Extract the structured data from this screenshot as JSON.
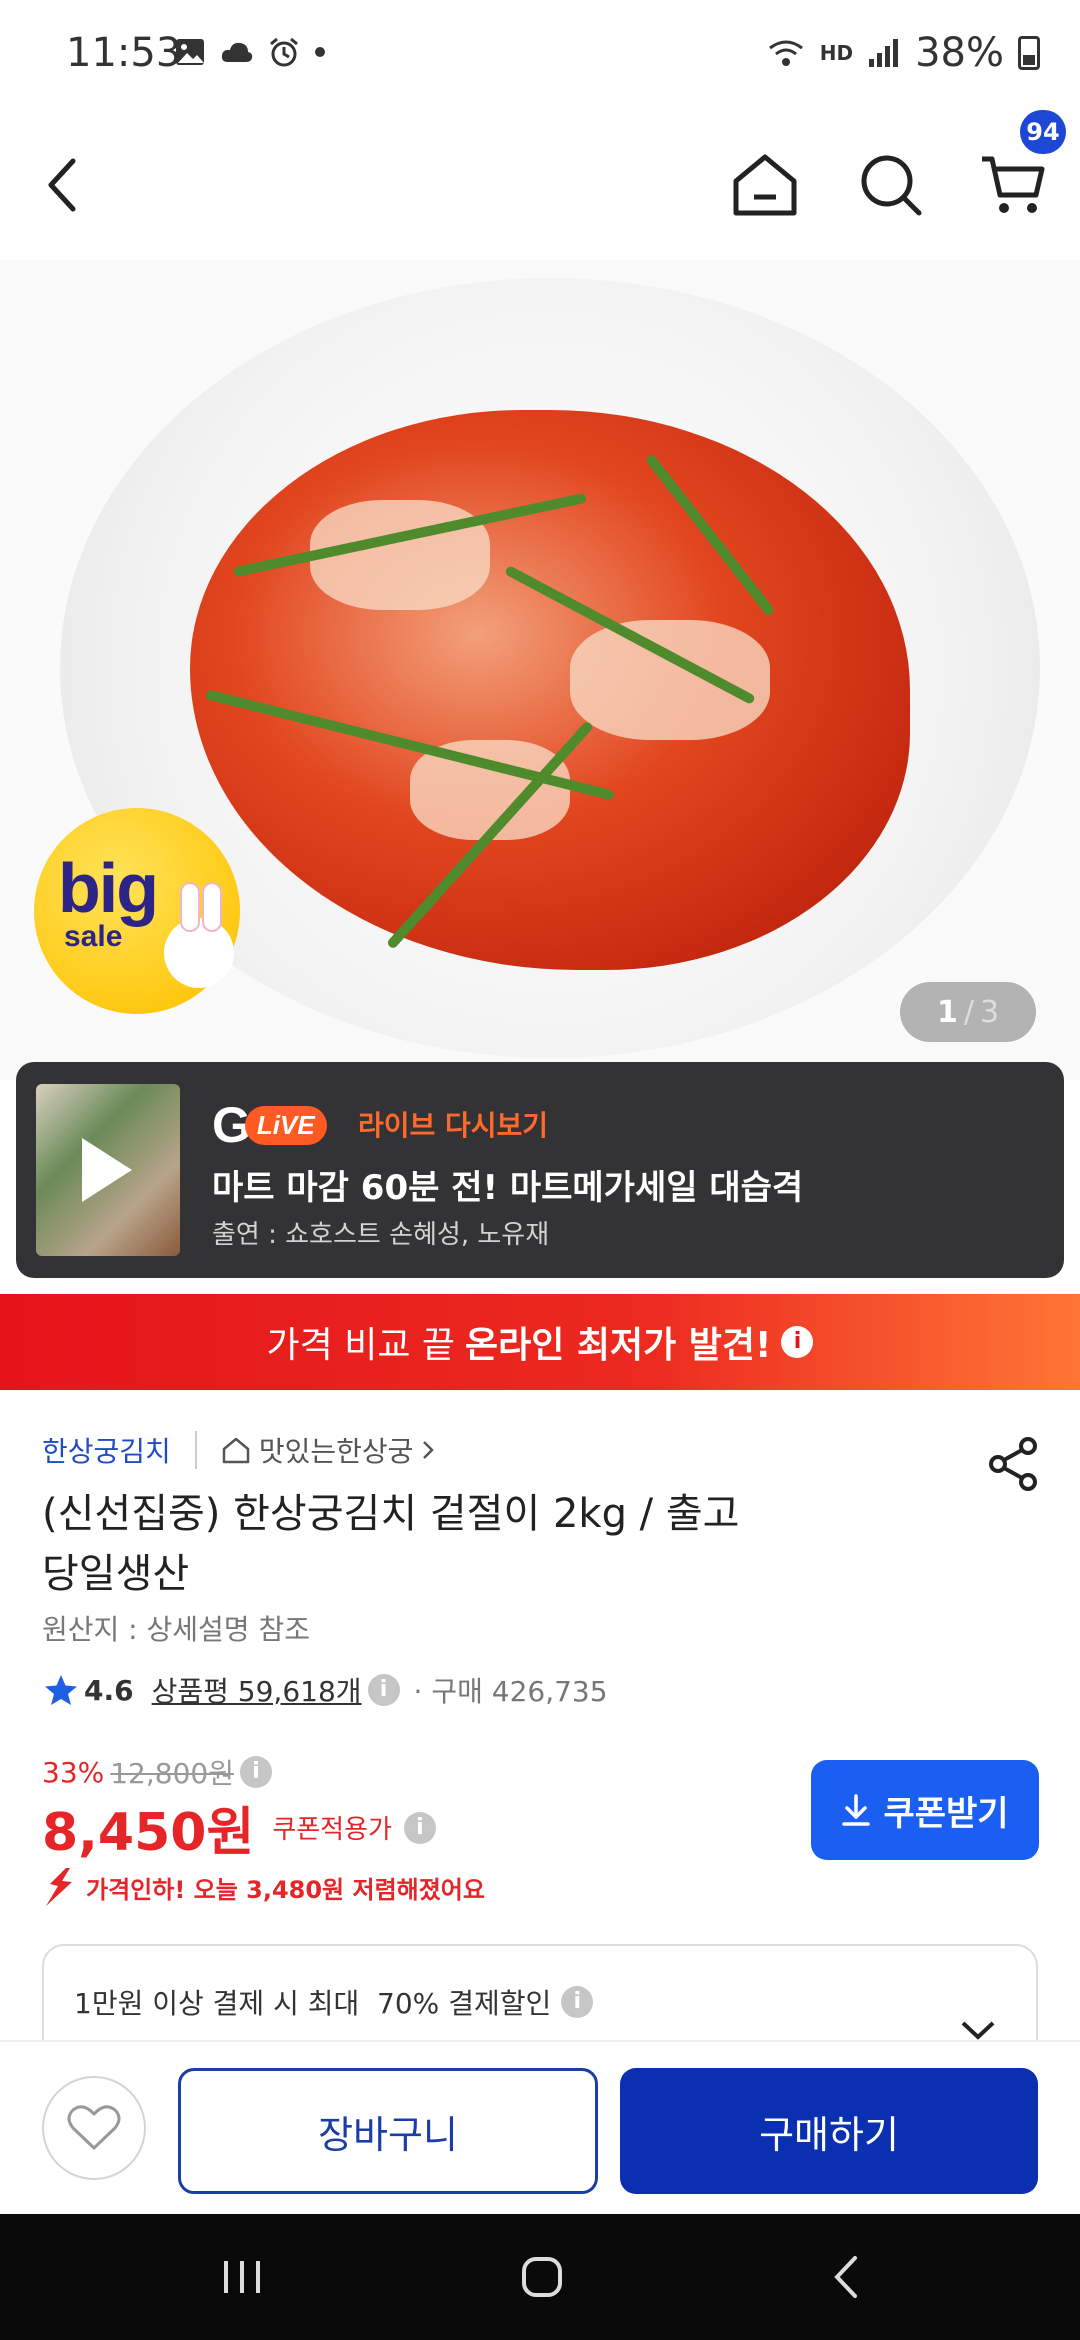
{
  "status_bar": {
    "time": "11:53",
    "network": "HD",
    "battery": "38%"
  },
  "header": {
    "cart_count": "94"
  },
  "gallery": {
    "current": "1",
    "separator": "/",
    "total": "3",
    "badge_big": "big",
    "badge_sale": "sale"
  },
  "live": {
    "logo_g": "G",
    "logo_live": "LiVE",
    "replay": "라이브 다시보기",
    "title": "마트 마감 60분 전! 마트메가세일 대습격",
    "cast": "출연 : 쇼호스트 손혜성, 노유재"
  },
  "promo": {
    "text": "가격 비교 끝",
    "highlight": "온라인 최저가 발견!",
    "info": "i"
  },
  "product": {
    "brand": "한상궁김치",
    "store_link": "맛있는한상궁",
    "title": "(신선집중) 한상궁김치 겉절이 2kg / 출고당일생산",
    "origin": "원산지 : 상세설명 참조",
    "rating": "4.6",
    "reviews": "상품평 59,618개",
    "purchases": "· 구매 426,735",
    "discount_pct": "33%",
    "original_price": "12,800원",
    "price": "8,450원",
    "price_label": "쿠폰적용가",
    "price_drop": "가격인하! 오늘 3,480원 저렴해졌어요",
    "coupon_button": "쿠폰받기",
    "payment_discount": "1만원 이상 결제 시 최대  70% 결제할인"
  },
  "actions": {
    "cart": "장바구니",
    "buy": "구매하기"
  },
  "colors": {
    "brand_blue": "#0a2fb0",
    "coupon_blue": "#1a5ff1",
    "price_red": "#e52528",
    "promo_red": "#e5141b"
  }
}
